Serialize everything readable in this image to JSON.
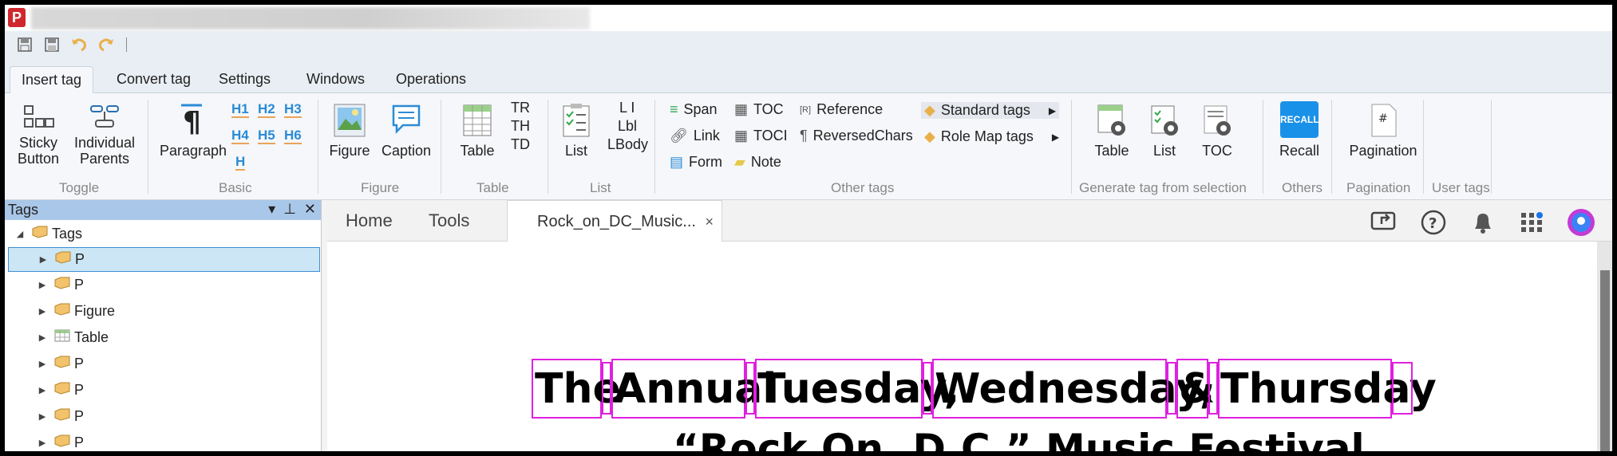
{
  "app": {
    "logo": "P"
  },
  "quick_access": [
    "save-icon",
    "save-as-icon",
    "undo-icon",
    "redo-icon"
  ],
  "ribbon_tabs": [
    "Insert tag",
    "Convert tag",
    "Settings",
    "Windows",
    "Operations"
  ],
  "ribbon": {
    "toggle": {
      "sticky": "Sticky\nButton",
      "individual": "Individual\nParents",
      "label": "Toggle"
    },
    "basic": {
      "paragraph": "Paragraph",
      "headings": [
        "H1",
        "H2",
        "H3",
        "H4",
        "H5",
        "H6",
        "H"
      ],
      "label": "Basic"
    },
    "figure": {
      "figure": "Figure",
      "caption": "Caption",
      "label": "Figure"
    },
    "table": {
      "table": "Table",
      "tr": "TR",
      "th": "TH",
      "td": "TD",
      "label": "Table"
    },
    "list": {
      "list": "List",
      "li": "L I",
      "lbl": "Lbl",
      "lbody": "LBody",
      "label": "List"
    },
    "other": {
      "span": "Span",
      "link": "Link",
      "form": "Form",
      "toc": "TOC",
      "toci": "TOCI",
      "note": "Note",
      "reference": "Reference",
      "reversed": "ReversedChars",
      "standard": "Standard tags",
      "rolemap": "Role Map tags",
      "label": "Other tags"
    },
    "generate": {
      "table": "Table",
      "list": "List",
      "toc": "TOC",
      "label": "Generate tag from selection"
    },
    "others": {
      "recall_icon": "RECALL",
      "recall": "Recall",
      "label": "Others"
    },
    "pagination": {
      "pagination": "Pagination",
      "label": "Pagination"
    },
    "user": {
      "label": "User tags"
    }
  },
  "tags_panel": {
    "title": "Tags",
    "root": "Tags",
    "items": [
      {
        "label": "P",
        "icon": "tag-icon"
      },
      {
        "label": "P",
        "icon": "tag-icon"
      },
      {
        "label": "Figure",
        "icon": "tag-icon"
      },
      {
        "label": "Table",
        "icon": "table-icon"
      },
      {
        "label": "P",
        "icon": "tag-icon"
      },
      {
        "label": "P",
        "icon": "tag-icon"
      },
      {
        "label": "P",
        "icon": "tag-icon"
      },
      {
        "label": "P",
        "icon": "tag-icon"
      }
    ]
  },
  "doc_nav": {
    "home": "Home",
    "tools": "Tools",
    "active_tab": "Rock_on_DC_Music...",
    "close": "×"
  },
  "document": {
    "heading_words": [
      "The",
      "Annual",
      "Tuesday,",
      "Wednesday,",
      "&",
      "Thursday"
    ],
    "subtitle": "“Rock On, D.C.” Music Festival"
  },
  "colors": {
    "tag_highlight": "#e020e0",
    "accent": "#1a91e8",
    "selected_row": "#cce6f6"
  }
}
